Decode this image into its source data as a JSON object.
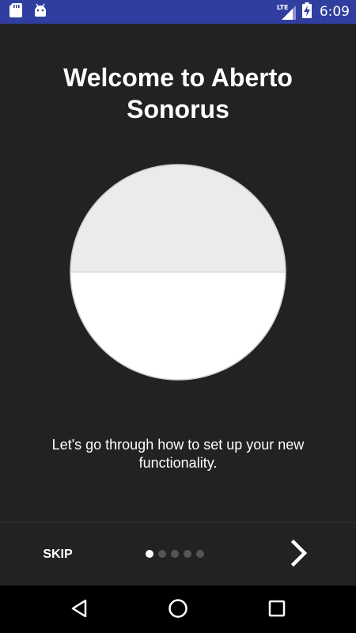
{
  "status_bar": {
    "network_label": "LTE",
    "time": "6:09",
    "icons": [
      "sd-card-icon",
      "android-icon",
      "signal-icon",
      "battery-charging-icon"
    ]
  },
  "onboarding": {
    "title": "Welcome to Aberto Sonorus",
    "description": "Let's go through how to set up your new functionality.",
    "page_count": 5,
    "current_page": 1
  },
  "controls": {
    "skip_label": "SKIP",
    "next_icon": "chevron-right-icon"
  },
  "nav_bar": {
    "icons": [
      "back-icon",
      "home-icon",
      "recents-icon"
    ]
  },
  "colors": {
    "status_bar": "#303f9f",
    "background": "#222222",
    "nav_bar": "#000000",
    "hero_top": "#ebebeb",
    "hero_bottom": "#ffffff",
    "dot_active": "#ffffff",
    "dot_inactive": "#555555"
  }
}
